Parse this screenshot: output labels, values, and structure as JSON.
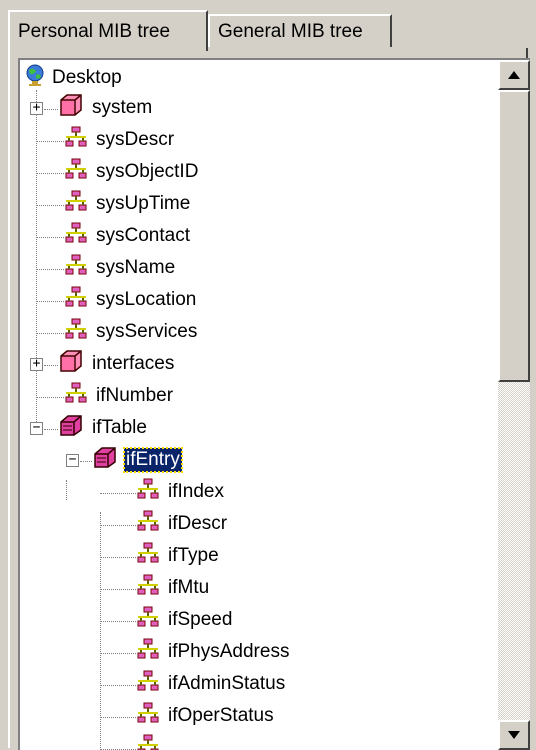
{
  "tabs": {
    "personal": "Personal MIB tree",
    "general": "General MIB tree"
  },
  "tree": {
    "root": "Desktop",
    "nodes": {
      "system": "system",
      "sysDescr": "sysDescr",
      "sysObjectID": "sysObjectID",
      "sysUpTime": "sysUpTime",
      "sysContact": "sysContact",
      "sysName": "sysName",
      "sysLocation": "sysLocation",
      "sysServices": "sysServices",
      "interfaces": "interfaces",
      "ifNumber": "ifNumber",
      "ifTable": "ifTable",
      "ifEntry": "ifEntry",
      "ifIndex": "ifIndex",
      "ifDescr": "ifDescr",
      "ifType": "ifType",
      "ifMtu": "ifMtu",
      "ifSpeed": "ifSpeed",
      "ifPhysAddress": "ifPhysAddress",
      "ifAdminStatus": "ifAdminStatus",
      "ifOperStatus": "ifOperStatus"
    },
    "selected": "ifEntry"
  },
  "icons": {
    "root": "globe-icon",
    "group": "cube-icon",
    "table": "open-cube-icon",
    "leaf": "network-node-icon"
  },
  "colors": {
    "selection": "#0a246a",
    "selection_outline": "#ffdd00",
    "folder": "#ff6fa8",
    "leaf_icon": "#c0c000"
  }
}
